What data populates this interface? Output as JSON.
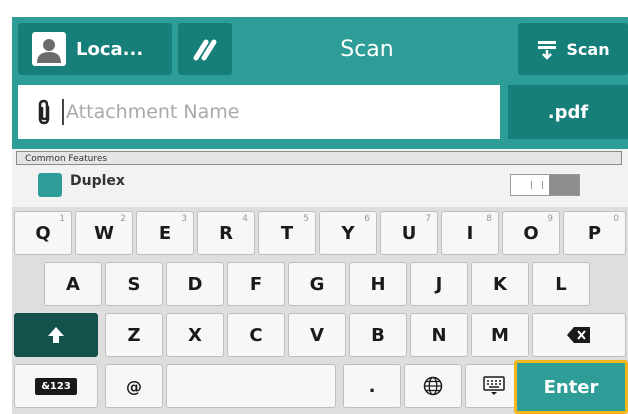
{
  "header": {
    "login_label": "Loca...",
    "title": "Scan",
    "scan_button_label": "Scan"
  },
  "attachment": {
    "placeholder": "Attachment Name",
    "extension": ".pdf"
  },
  "features": {
    "header": "Common Features",
    "item_label": "Duplex"
  },
  "keyboard": {
    "row1": [
      {
        "label": "Q",
        "sub": "1"
      },
      {
        "label": "W",
        "sub": "2"
      },
      {
        "label": "E",
        "sub": "3"
      },
      {
        "label": "R",
        "sub": "4"
      },
      {
        "label": "T",
        "sub": "5"
      },
      {
        "label": "Y",
        "sub": "6"
      },
      {
        "label": "U",
        "sub": "7"
      },
      {
        "label": "I",
        "sub": "8"
      },
      {
        "label": "O",
        "sub": "9"
      },
      {
        "label": "P",
        "sub": "0"
      }
    ],
    "row2": [
      "A",
      "S",
      "D",
      "F",
      "G",
      "H",
      "J",
      "K",
      "L"
    ],
    "row3": [
      "Z",
      "X",
      "C",
      "V",
      "B",
      "N",
      "M"
    ],
    "row4": {
      "symbols": "&123",
      "at": "@",
      "period": ".",
      "enter": "Enter"
    }
  },
  "colors": {
    "accent": "#2e9c97",
    "button_dark": "#167f79",
    "enter_border": "#f2b71b",
    "shift_key": "#14504c"
  }
}
